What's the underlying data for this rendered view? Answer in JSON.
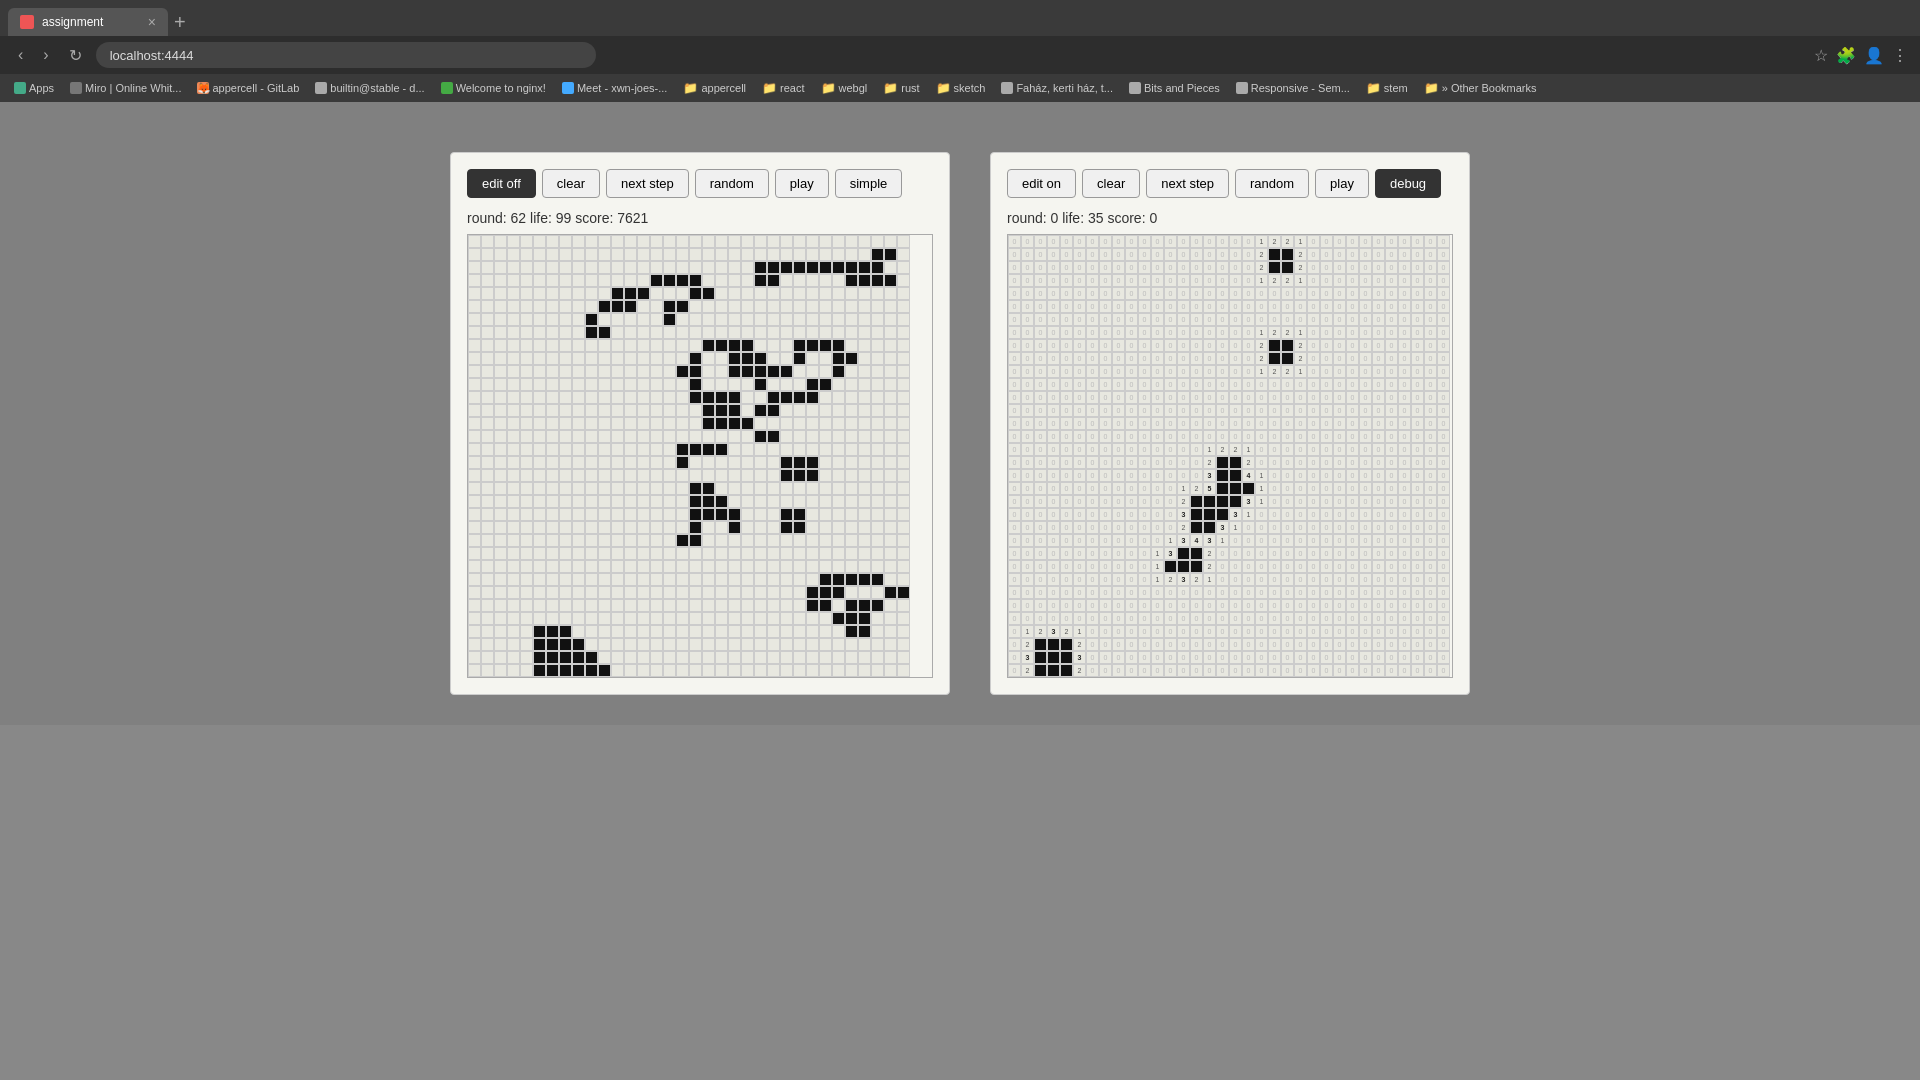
{
  "browser": {
    "tab": {
      "favicon_color": "#e55",
      "title": "assignment",
      "close_label": "×"
    },
    "new_tab_label": "+",
    "address": "localhost:4444",
    "nav": {
      "back": "‹",
      "forward": "›",
      "reload": "↻"
    },
    "bookmarks": [
      {
        "label": "Apps",
        "type": "apps"
      },
      {
        "label": "Miro | Online Whit...",
        "type": "link"
      },
      {
        "label": "appercell - GitLab",
        "type": "link"
      },
      {
        "label": "builtin@stable - d...",
        "type": "link"
      },
      {
        "label": "Welcome to nginx!",
        "type": "link"
      },
      {
        "label": "Meet - xwn-joes-...",
        "type": "link"
      },
      {
        "label": "appercell",
        "type": "folder"
      },
      {
        "label": "react",
        "type": "folder"
      },
      {
        "label": "webgl",
        "type": "folder"
      },
      {
        "label": "rust",
        "type": "folder"
      },
      {
        "label": "sketch",
        "type": "folder"
      },
      {
        "label": "Faház, kerti ház, t...",
        "type": "link"
      },
      {
        "label": "Bits and Pieces",
        "type": "link"
      },
      {
        "label": "Responsive - Sem...",
        "type": "link"
      },
      {
        "label": "stem",
        "type": "folder"
      },
      {
        "label": "» Other Bookmarks",
        "type": "folder"
      }
    ]
  },
  "left_panel": {
    "buttons": {
      "edit_off": "edit off",
      "clear": "clear",
      "next_step": "next step",
      "random": "random",
      "play": "play",
      "simple": "simple"
    },
    "status": "round: 62 life: 99 score: 7621",
    "cols": 34,
    "rows": 34
  },
  "right_panel": {
    "buttons": {
      "edit_on": "edit on",
      "clear": "clear",
      "next_step": "next step",
      "random": "random",
      "play": "play",
      "debug": "debug"
    },
    "status": "round: 0 life: 35 score: 0",
    "cols": 34,
    "rows": 34
  },
  "colors": {
    "accent": "#333333",
    "button_bg": "#f0f0f0",
    "button_border": "#999999",
    "cell_dead": "#e8e8e0",
    "cell_alive": "#111111"
  }
}
